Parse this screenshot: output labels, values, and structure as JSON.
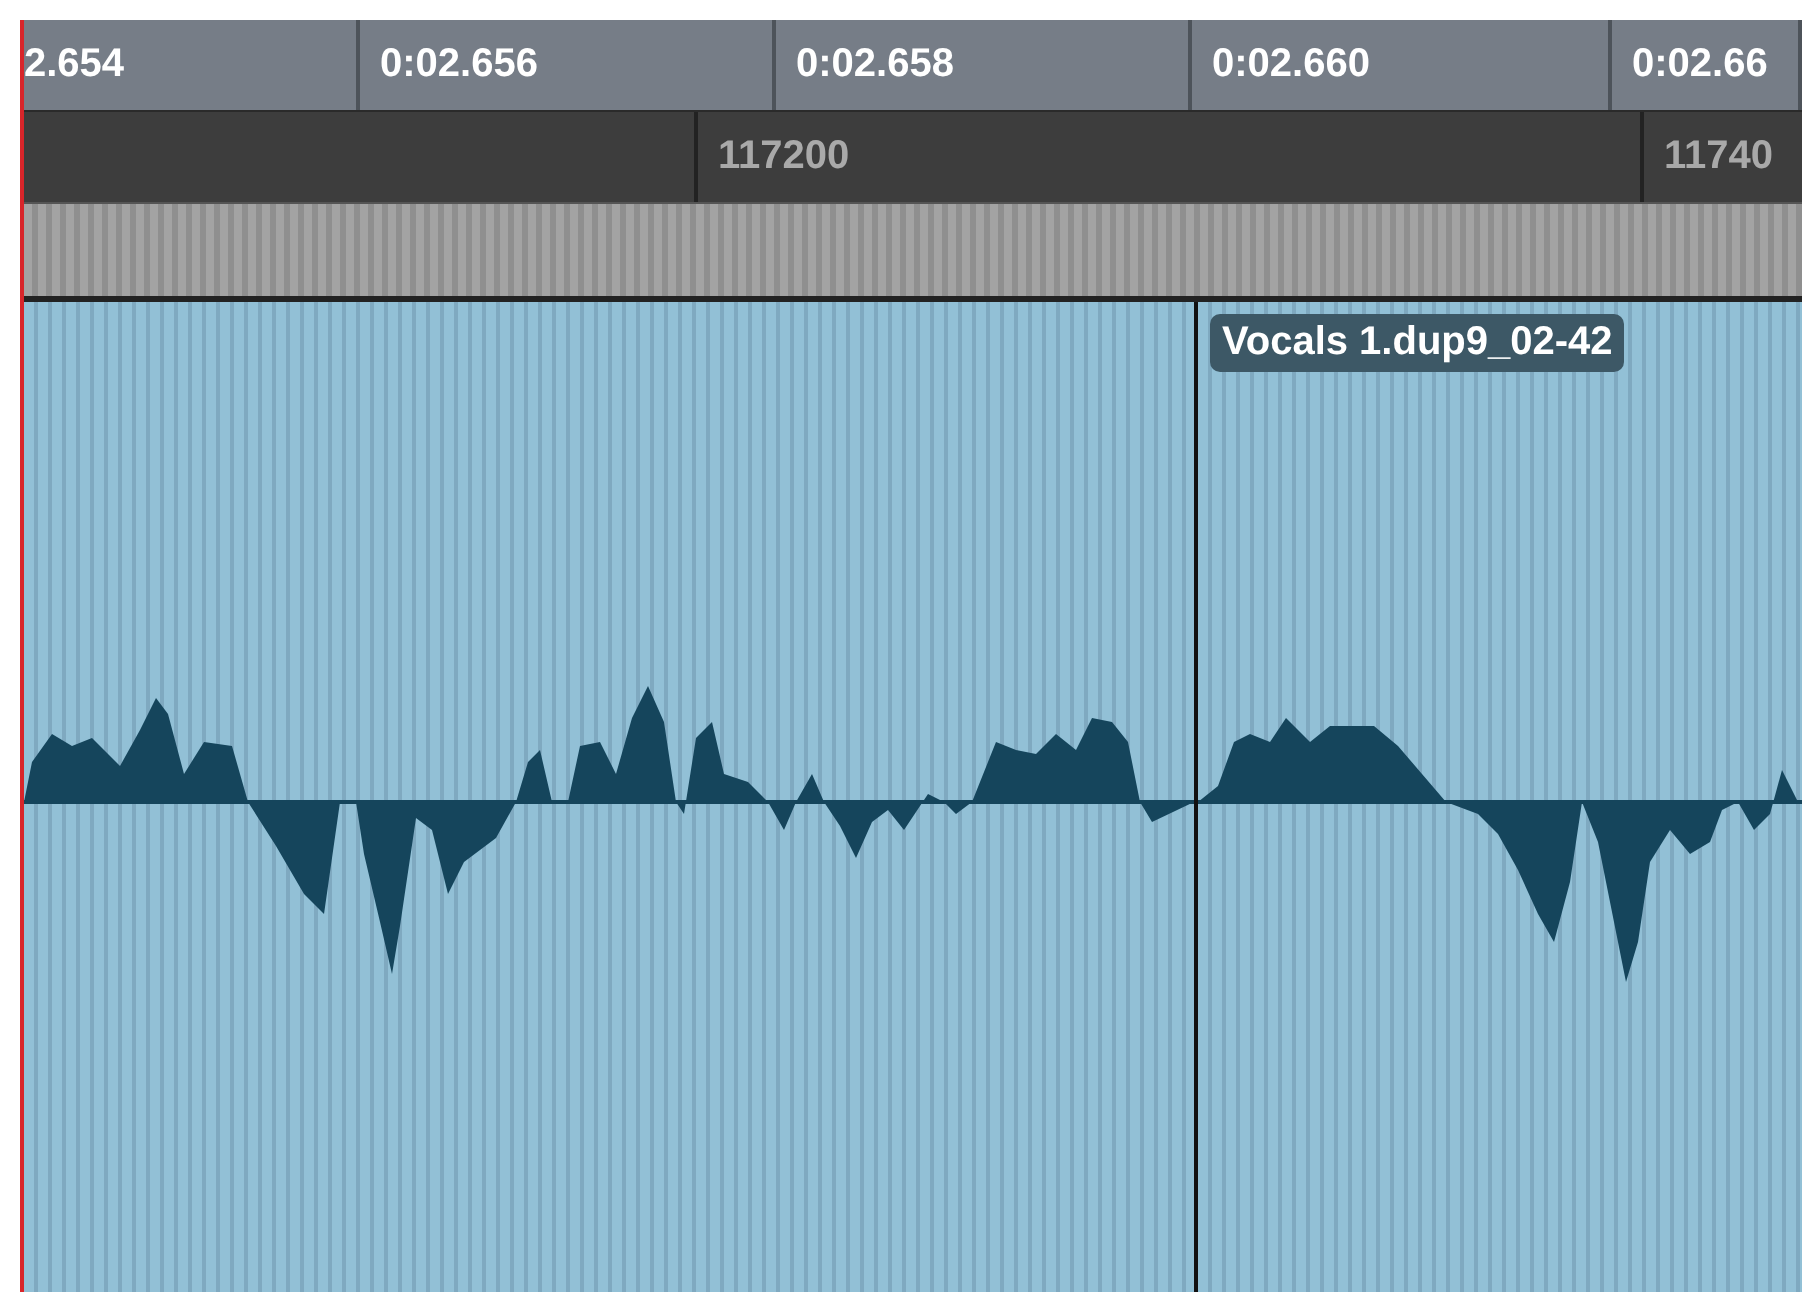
{
  "time_ruler": {
    "labels": [
      "2.654",
      "0:02.656",
      "0:02.658",
      "0:02.660",
      "0:02.66"
    ]
  },
  "sample_ruler": {
    "labels": [
      "117200",
      "11740"
    ]
  },
  "clip": {
    "name": "Vocals 1.dup9_02-42"
  }
}
